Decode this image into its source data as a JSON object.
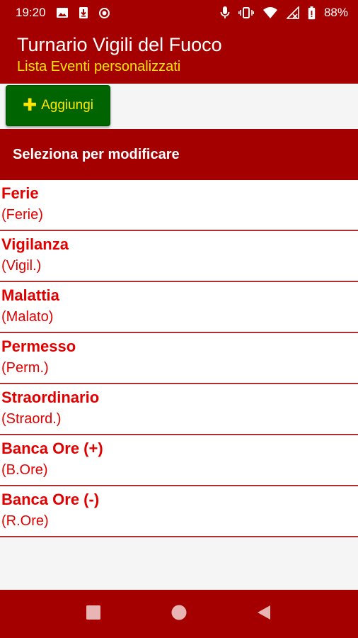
{
  "status_bar": {
    "time": "19:20",
    "battery": "88%"
  },
  "app_bar": {
    "title": "Turnario Vigili del Fuoco",
    "subtitle": "Lista Eventi personalizzati"
  },
  "toolbar": {
    "add_label": "Aggiungi",
    "add_icon": "plus-icon"
  },
  "section": {
    "header": "Seleziona per modificare"
  },
  "events": [
    {
      "name": "Ferie",
      "abbr": "(Ferie)"
    },
    {
      "name": "Vigilanza",
      "abbr": "(Vigil.)"
    },
    {
      "name": "Malattia",
      "abbr": "(Malato)"
    },
    {
      "name": "Permesso",
      "abbr": "(Perm.)"
    },
    {
      "name": "Straordinario",
      "abbr": "(Straord.)"
    },
    {
      "name": "Banca Ore (+)",
      "abbr": "(B.Ore)"
    },
    {
      "name": "Banca Ore (-)",
      "abbr": "(R.Ore)"
    }
  ],
  "colors": {
    "primary": "#a50000",
    "accent_yellow": "#ffe600",
    "button_green": "#006400",
    "item_text": "#e00000"
  },
  "nav": {
    "icons": [
      "recents-square-icon",
      "home-circle-icon",
      "back-triangle-icon"
    ]
  }
}
